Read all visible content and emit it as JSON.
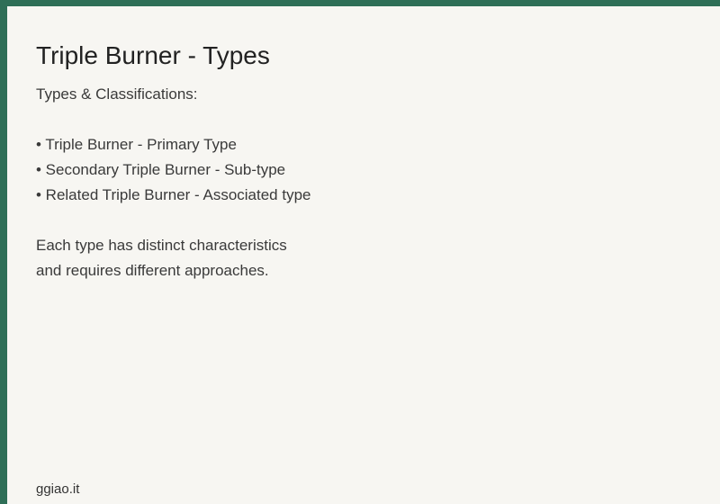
{
  "page": {
    "title": "Triple Burner - Types",
    "subtitle": "Types & Classifications:",
    "bullets": [
      "• Triple Burner - Primary Type",
      "• Secondary Triple Burner - Sub-type",
      "• Related Triple Burner - Associated type"
    ],
    "description_lines": [
      "Each type has distinct characteristics",
      "and requires different approaches."
    ],
    "footer": "ggiao.it"
  },
  "colors": {
    "border": "#2f6f57",
    "background": "#f7f6f2",
    "text": "#3a3a3a",
    "title": "#222222"
  }
}
